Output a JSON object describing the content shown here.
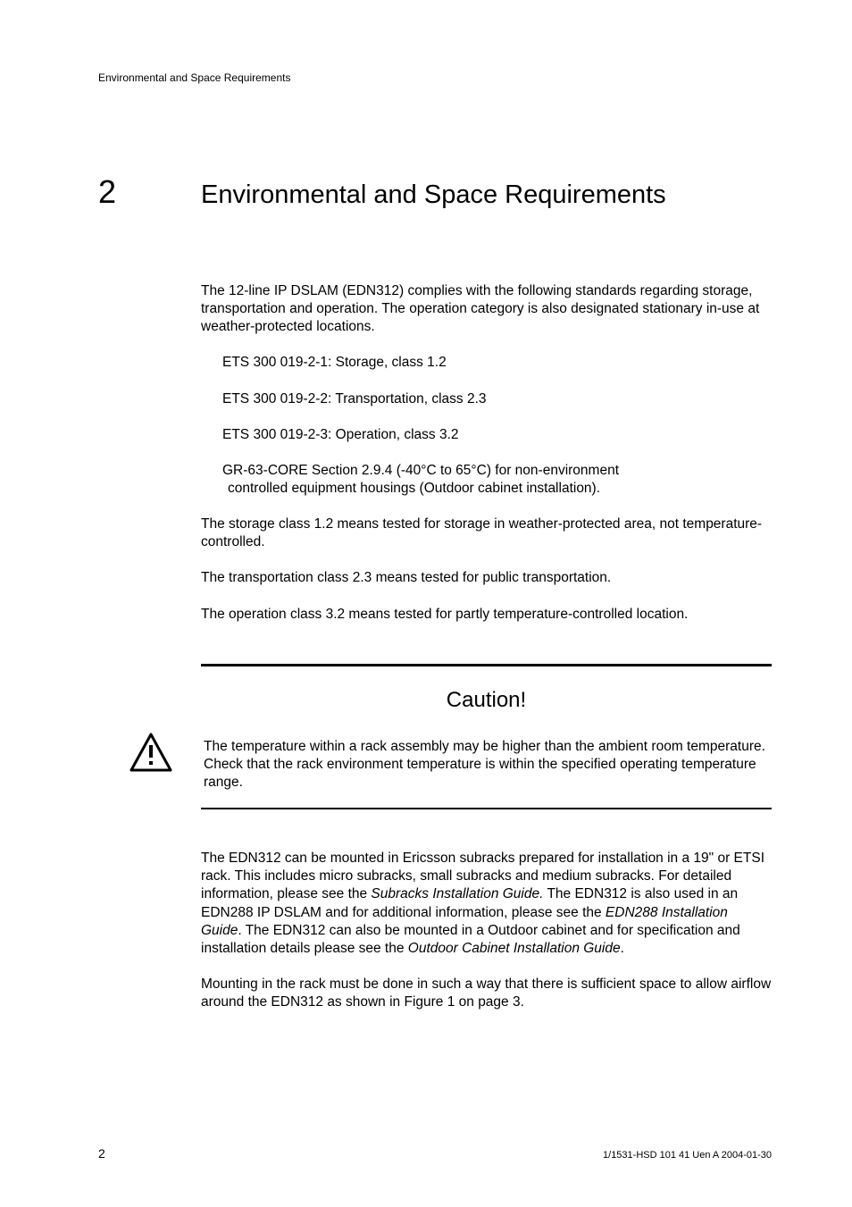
{
  "header": {
    "breadcrumb": "Environmental and Space Requirements"
  },
  "section": {
    "number": "2",
    "title": "Environmental and Space Requirements"
  },
  "intro": "The 12-line IP DSLAM (EDN312) complies with the following standards regarding storage, transportation and operation. The operation category is also designated stationary in-use at weather-protected locations.",
  "bullets": {
    "b1": "ETS 300 019-2-1: Storage, class 1.2",
    "b2": "ETS 300 019-2-2: Transportation, class 2.3",
    "b3": "ETS 300 019-2-3: Operation, class 3.2",
    "b4_line1": "GR-63-CORE Section 2.9.4 (-40°C to 65°C) for non-environment",
    "b4_line2": "controlled equipment housings (Outdoor cabinet installation)."
  },
  "para1": "The storage class 1.2  means tested for storage in weather-protected area, not temperature-controlled.",
  "para2": "The transportation class 2.3 means tested for public transportation.",
  "para3": "The operation class 3.2 means tested for partly temperature-controlled location.",
  "caution": {
    "heading": "Caution!",
    "text": "The temperature within a rack assembly may be higher than the ambient room temperature. Check that the rack environment temperature is within the specified operating temperature range."
  },
  "para4": {
    "t1": "The EDN312 can be mounted in Ericsson subracks prepared for installation in a 19\" or ETSI rack. This includes micro subracks, small subracks and medium subracks. For detailed information, please see the ",
    "i1": "Subracks Installation Guide.",
    "t2": " The EDN312 is also used in an EDN288 IP DSLAM and for additional information, please see the ",
    "i2": "EDN288 Installation Guide",
    "t3": ". The EDN312 can also be mounted in a Outdoor cabinet and for specification and installation details please see the ",
    "i3": "Outdoor Cabinet Installation Guide",
    "t4": "."
  },
  "para5": "Mounting in the rack must be done in such a way that there is sufficient space to allow airflow around the EDN312 as shown in Figure 1 on page 3.",
  "footer": {
    "page_number": "2",
    "doc_id": "1/1531-HSD 101 41 Uen A  2004-01-30"
  }
}
